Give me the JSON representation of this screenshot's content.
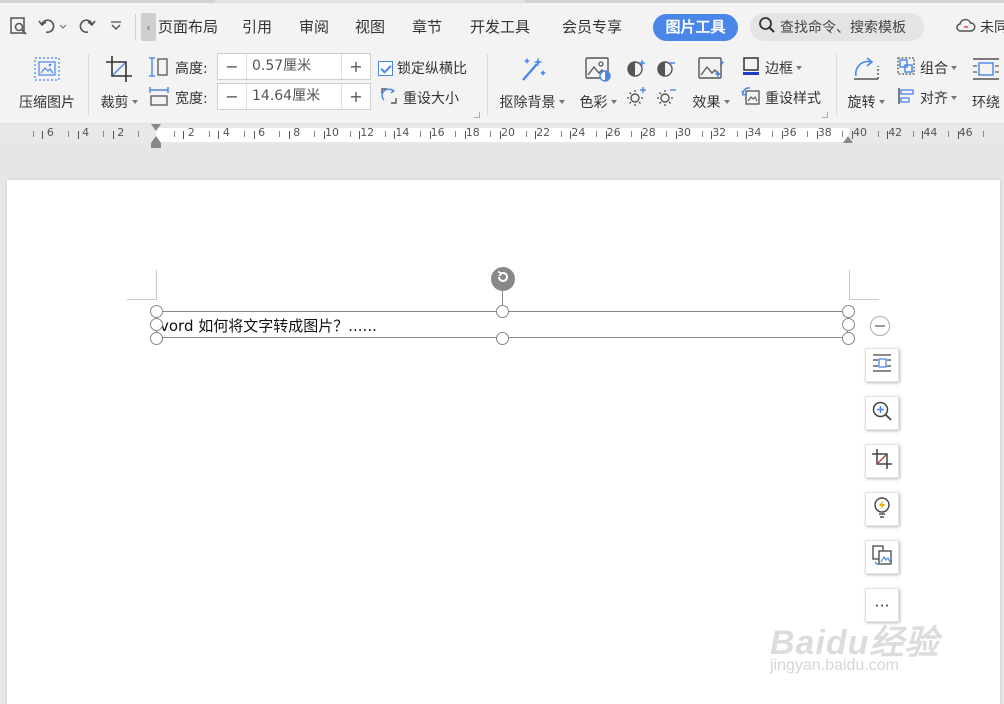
{
  "menu": {
    "items": [
      "页面布局",
      "引用",
      "审阅",
      "视图",
      "章节",
      "开发工具",
      "会员专享"
    ],
    "active_tab": "图片工具",
    "search_placeholder": "查找命令、搜索模板",
    "sync_label": "未同"
  },
  "ribbon": {
    "compress_label": "压缩图片",
    "crop_label": "裁剪",
    "height_label": "高度:",
    "height_value": "0.57厘米",
    "width_label": "宽度:",
    "width_value": "14.64厘米",
    "lock_ratio_label": "锁定纵横比",
    "reset_size_label": "重设大小",
    "remove_bg_label": "抠除背景",
    "color_label": "色彩",
    "effects_label": "效果",
    "border_label": "边框",
    "reset_style_label": "重设样式",
    "rotate_label": "旋转",
    "group_label": "组合",
    "align_label": "对齐",
    "wrap_label": "环绕",
    "spin_minus": "−",
    "spin_plus": "+"
  },
  "ruler": {
    "left_numbers": [
      "6",
      "4",
      "2"
    ],
    "numbers": [
      "2",
      "4",
      "6",
      "8",
      "10",
      "12",
      "14",
      "16",
      "18",
      "20",
      "22",
      "24",
      "26",
      "28",
      "30",
      "32",
      "34",
      "36",
      "38",
      "40",
      "42",
      "44",
      "46"
    ]
  },
  "document": {
    "picture_text": "vord 如何将文字转成图片？......"
  },
  "float_toolbar": {
    "more_label": "···"
  },
  "watermark": {
    "brand": "Baidu经验",
    "url": "jingyan.baidu.com"
  }
}
